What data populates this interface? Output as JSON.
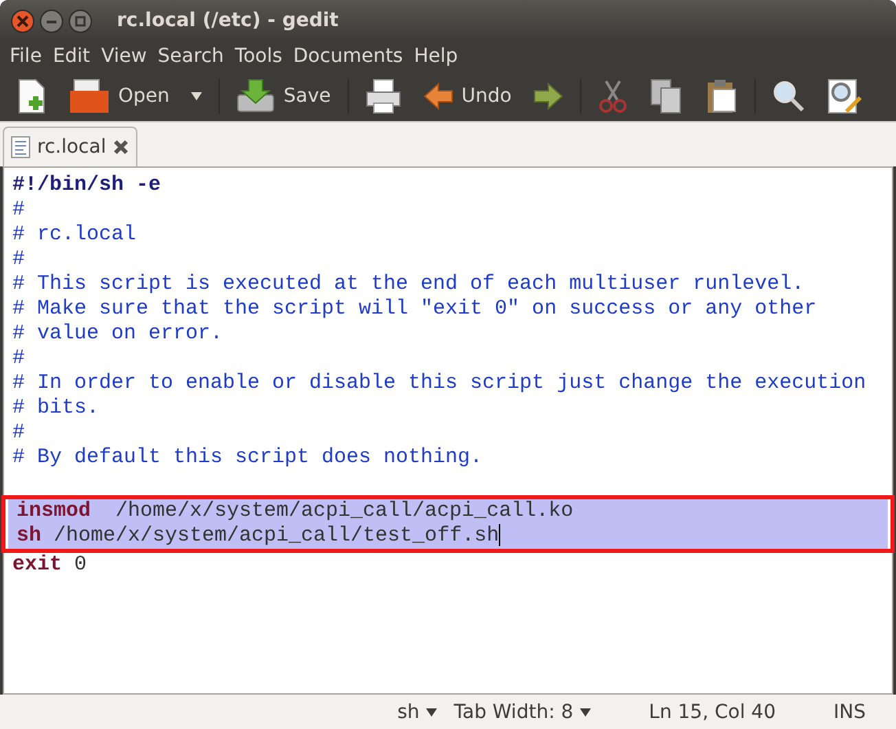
{
  "window": {
    "title": "rc.local (/etc) - gedit"
  },
  "menu": [
    "File",
    "Edit",
    "View",
    "Search",
    "Tools",
    "Documents",
    "Help"
  ],
  "toolbar": [
    {
      "kind": "new"
    },
    {
      "kind": "open",
      "label": "Open"
    },
    {
      "kind": "save",
      "label": "Save"
    },
    {
      "kind": "print"
    },
    {
      "kind": "undo",
      "label": "Undo"
    },
    {
      "kind": "redo"
    },
    {
      "kind": "cut"
    },
    {
      "kind": "copy"
    },
    {
      "kind": "paste"
    },
    {
      "kind": "find"
    },
    {
      "kind": "replace"
    }
  ],
  "tabs": [
    {
      "label": "rc.local",
      "selected": true
    }
  ],
  "editor": {
    "lines": [
      {
        "selected": false,
        "tokens": [
          {
            "kind": "shebang",
            "text": "#!/bin/sh -e"
          }
        ]
      },
      {
        "selected": false,
        "tokens": [
          {
            "kind": "comment",
            "text": "#"
          }
        ]
      },
      {
        "selected": false,
        "tokens": [
          {
            "kind": "comment",
            "text": "# rc.local"
          }
        ]
      },
      {
        "selected": false,
        "tokens": [
          {
            "kind": "comment",
            "text": "#"
          }
        ]
      },
      {
        "selected": false,
        "tokens": [
          {
            "kind": "comment",
            "text": "# This script is executed at the end of each multiuser runlevel."
          }
        ]
      },
      {
        "selected": false,
        "tokens": [
          {
            "kind": "comment",
            "text": "# Make sure that the script will \"exit 0\" on success or any other"
          }
        ]
      },
      {
        "selected": false,
        "tokens": [
          {
            "kind": "comment",
            "text": "# value on error."
          }
        ]
      },
      {
        "selected": false,
        "tokens": [
          {
            "kind": "comment",
            "text": "#"
          }
        ]
      },
      {
        "selected": false,
        "tokens": [
          {
            "kind": "comment",
            "text": "# In order to enable or disable this script just change the execution"
          }
        ]
      },
      {
        "selected": false,
        "tokens": [
          {
            "kind": "comment",
            "text": "# bits."
          }
        ]
      },
      {
        "selected": false,
        "tokens": [
          {
            "kind": "comment",
            "text": "#"
          }
        ]
      },
      {
        "selected": false,
        "tokens": [
          {
            "kind": "comment",
            "text": "# By default this script does nothing."
          }
        ]
      },
      {
        "selected": false
      },
      {
        "selected": true,
        "tokens": [
          {
            "kind": "keyword",
            "text": "insmod"
          },
          {
            "kind": "plain",
            "text": "  /home/x/system/acpi_call/acpi_call.ko"
          }
        ]
      },
      {
        "selected": true,
        "cursor": true,
        "tokens": [
          {
            "kind": "keyword",
            "text": "sh"
          },
          {
            "kind": "plain",
            "text": " /home/x/system/acpi_call/test_off.sh"
          }
        ]
      },
      {
        "selected": false,
        "tokens": [
          {
            "kind": "keyword",
            "text": "exit"
          },
          {
            "kind": "plain",
            "text": " 0"
          }
        ]
      }
    ]
  },
  "status_bar": {
    "language": "sh",
    "tab_width": "Tab Width:  8",
    "position": "Ln 15, Col 40",
    "mode": "INS"
  }
}
